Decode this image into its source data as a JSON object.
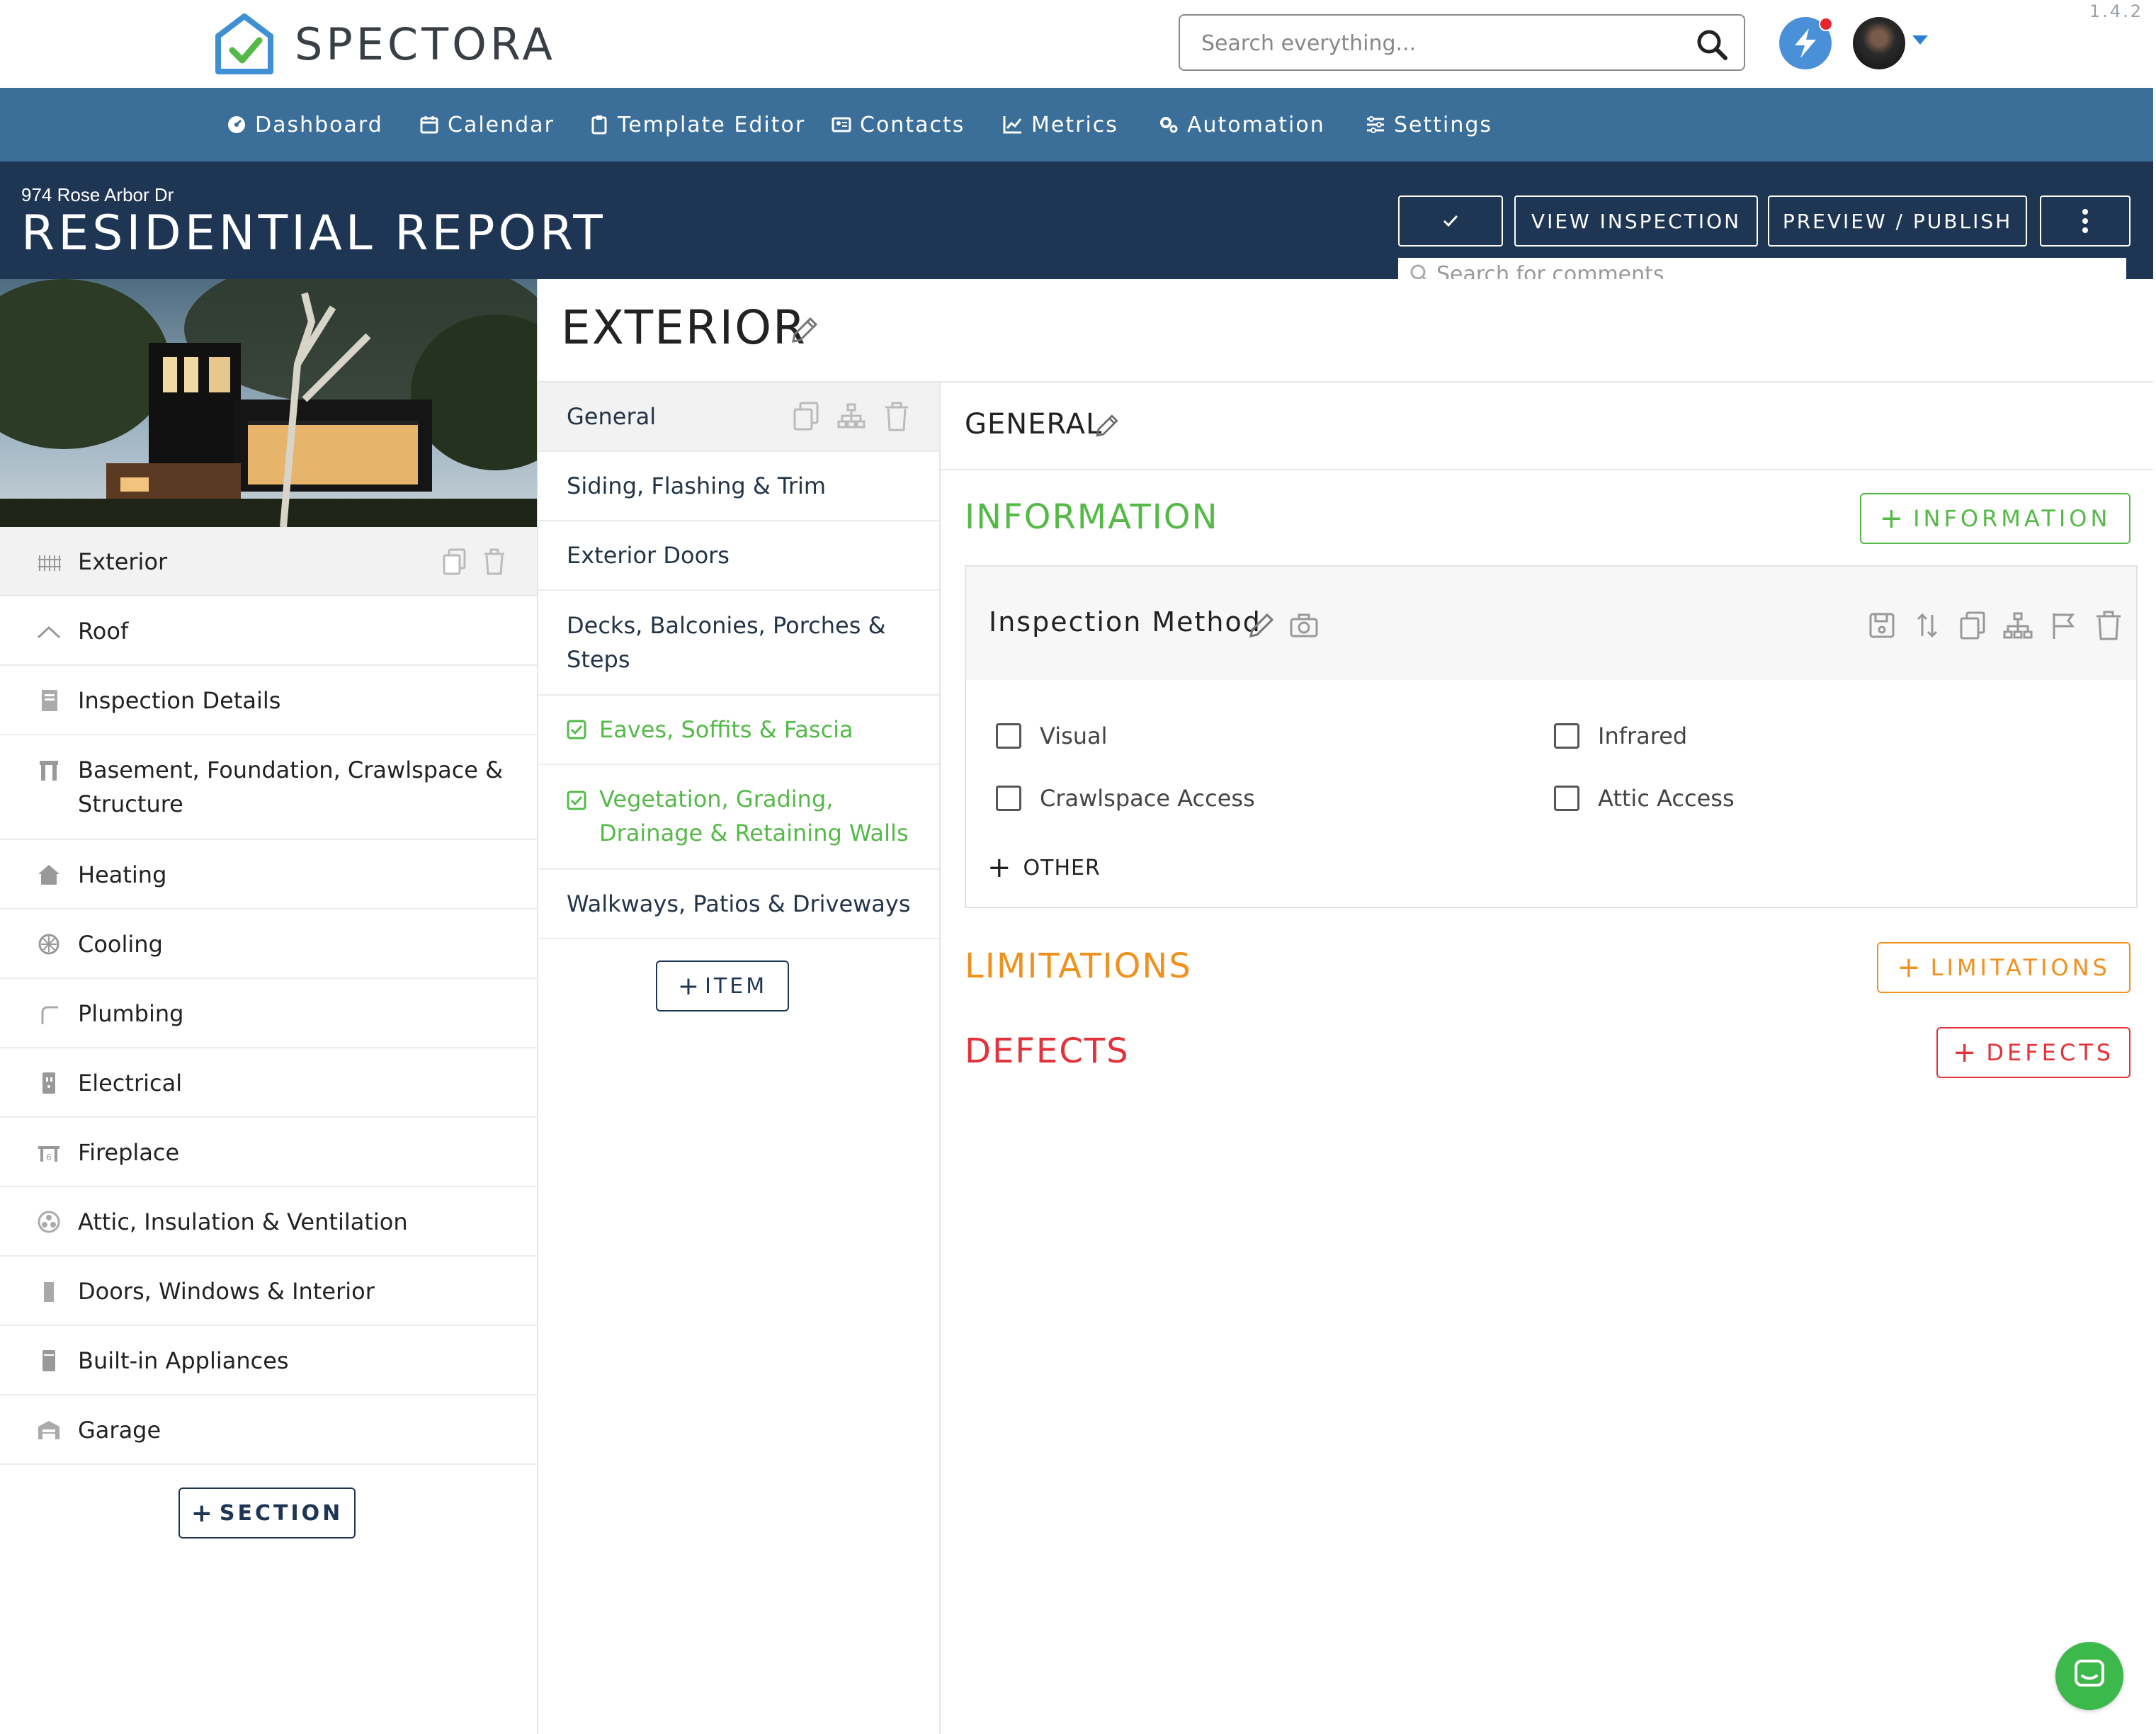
{
  "app": {
    "brand": "SPECTORA",
    "version": "1.4.2",
    "search_placeholder": "Search everything..."
  },
  "nav": {
    "items": [
      {
        "label": "Dashboard",
        "icon": "dashboard-icon"
      },
      {
        "label": "Calendar",
        "icon": "calendar-icon"
      },
      {
        "label": "Template Editor",
        "icon": "clipboard-icon"
      },
      {
        "label": "Contacts",
        "icon": "contact-card-icon"
      },
      {
        "label": "Metrics",
        "icon": "line-chart-icon"
      },
      {
        "label": "Automation",
        "icon": "gears-icon"
      },
      {
        "label": "Settings",
        "icon": "sliders-icon"
      }
    ]
  },
  "report": {
    "address": "974 Rose Arbor Dr",
    "title": "RESIDENTIAL REPORT",
    "buttons": {
      "view": "VIEW INSPECTION",
      "preview": "PREVIEW / PUBLISH"
    },
    "comment_search_placeholder": "Search for comments"
  },
  "sections": [
    {
      "label": "Exterior",
      "icon": "fence-icon",
      "active": true
    },
    {
      "label": "Roof",
      "icon": "roof-icon"
    },
    {
      "label": "Inspection Details",
      "icon": "document-icon"
    },
    {
      "label": "Basement, Foundation, Crawlspace & Structure",
      "icon": "foundation-icon"
    },
    {
      "label": "Heating",
      "icon": "house-heat-icon"
    },
    {
      "label": "Cooling",
      "icon": "snowflake-icon"
    },
    {
      "label": "Plumbing",
      "icon": "pipe-icon"
    },
    {
      "label": "Electrical",
      "icon": "outlet-icon"
    },
    {
      "label": "Fireplace",
      "icon": "fireplace-icon"
    },
    {
      "label": "Attic, Insulation & Ventilation",
      "icon": "fan-icon"
    },
    {
      "label": "Doors, Windows & Interior",
      "icon": "door-icon"
    },
    {
      "label": "Built-in Appliances",
      "icon": "appliance-icon"
    },
    {
      "label": "Garage",
      "icon": "garage-icon"
    }
  ],
  "add_section_label": "SECTION",
  "section_title": "EXTERIOR",
  "items": [
    {
      "label": "General",
      "active": true
    },
    {
      "label": "Siding, Flashing & Trim"
    },
    {
      "label": "Exterior Doors"
    },
    {
      "label": "Decks, Balconies, Porches & Steps"
    },
    {
      "label": "Eaves, Soffits & Fascia",
      "done": true
    },
    {
      "label": "Vegetation, Grading, Drainage & Retaining Walls",
      "done": true
    },
    {
      "label": "Walkways, Patios & Driveways"
    }
  ],
  "add_item_label": "ITEM",
  "item_detail": {
    "title": "GENERAL",
    "information": {
      "heading": "INFORMATION",
      "button": "INFORMATION",
      "color": "#55b948"
    },
    "limitations": {
      "heading": "LIMITATIONS",
      "button": "LIMITATIONS",
      "color": "#f0911e"
    },
    "defects": {
      "heading": "DEFECTS",
      "button": "DEFECTS",
      "color": "#e2323a"
    },
    "card": {
      "title": "Inspection Method",
      "options": [
        "Visual",
        "Infrared",
        "Crawlspace Access",
        "Attic Access"
      ],
      "other_label": "OTHER"
    }
  },
  "colors": {
    "nav": "#3b6e98",
    "header": "#1e3654",
    "done": "#55b948"
  }
}
